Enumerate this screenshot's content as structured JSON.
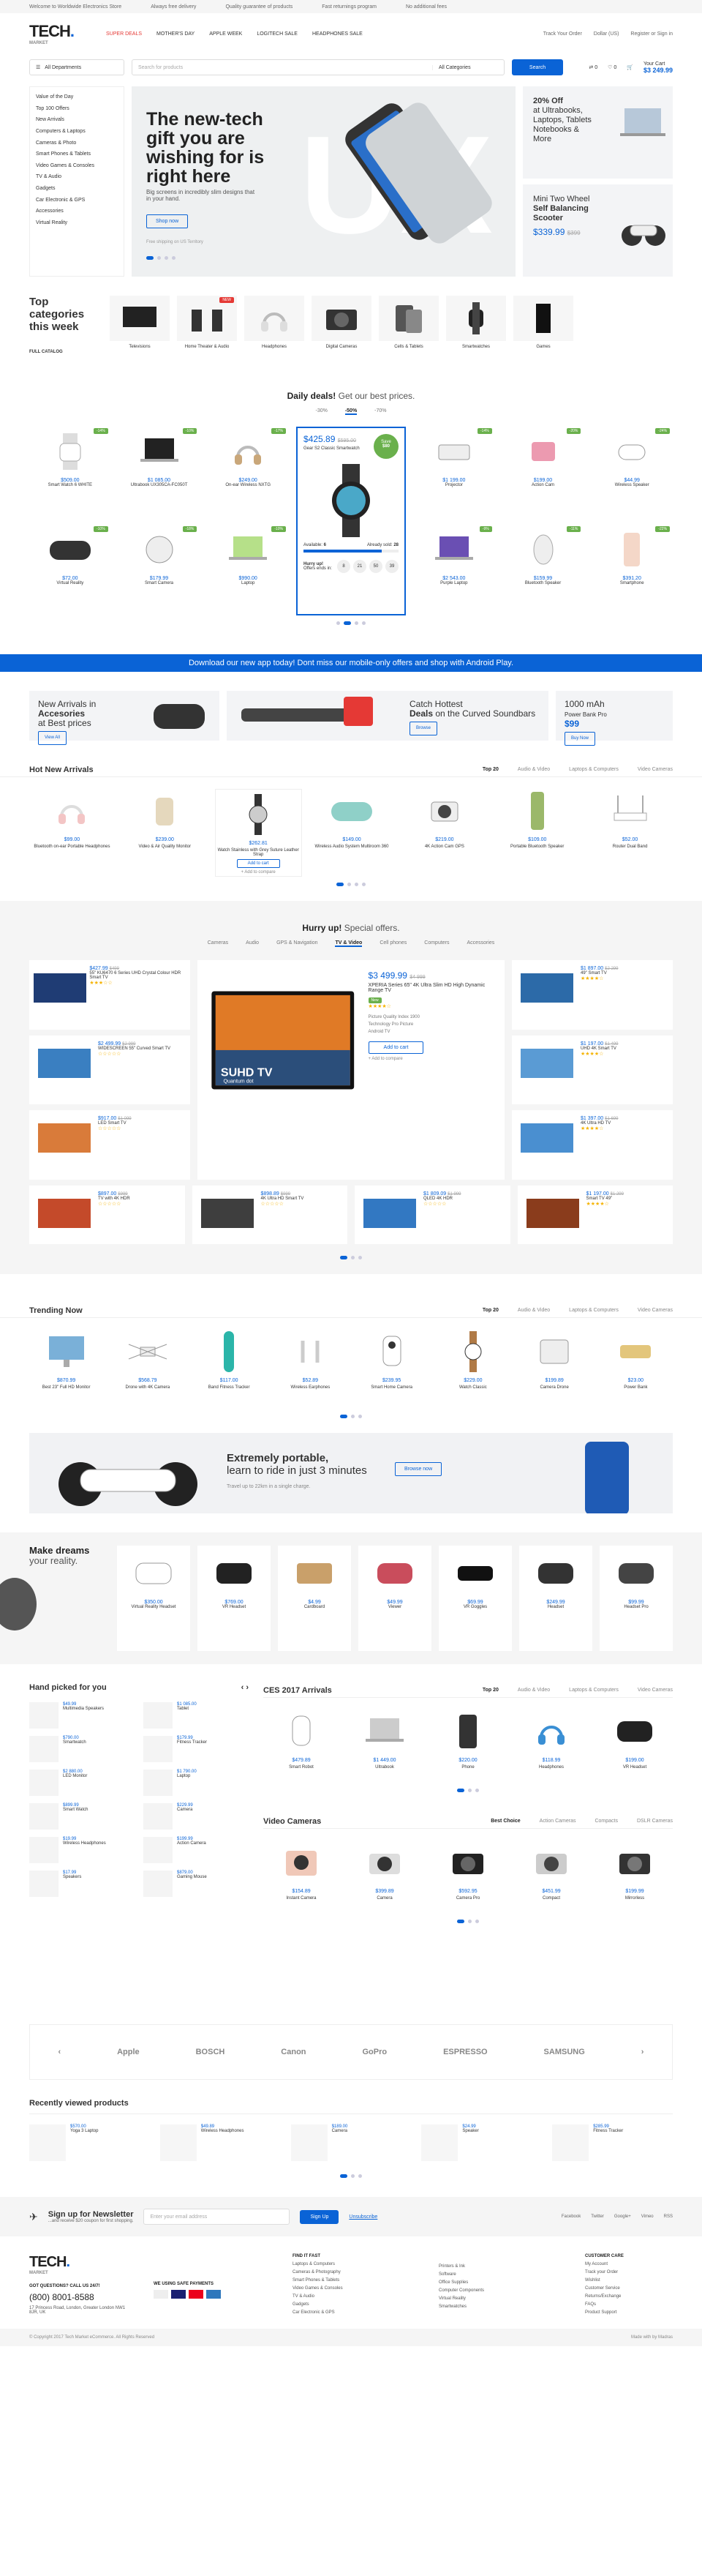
{
  "topbar": {
    "msg1": "Welcome to Worldwide Electronics Store",
    "msg2": "Always free delivery",
    "msg3": "Quality guarantee of products",
    "msg4": "Fast returnings program",
    "msg5": "No additional fees"
  },
  "logo": {
    "name": "TECH",
    "sub": "MARKET"
  },
  "nav": [
    "SUPER DEALS",
    "MOTHER'S DAY",
    "APPLE WEEK",
    "LOGITECH SALE",
    "HEADPHONES SALE"
  ],
  "header_right": {
    "track": "Track Your Order",
    "currency": "Dollar (US)",
    "account": "Register or Sign in"
  },
  "search": {
    "dept": "All Departments",
    "placeholder": "Search for products",
    "category": "All Categories",
    "button": "Search"
  },
  "cart": {
    "count1": "0",
    "count2": "0",
    "label": "Your Cart",
    "total": "$3 249.99"
  },
  "sidebar": [
    "Value of the Day",
    "Top 100 Offers",
    "New Arrivals",
    "Computers & Laptops",
    "Cameras & Photo",
    "Smart Phones & Tablets",
    "Video Games & Consoles",
    "TV & Audio",
    "Gadgets",
    "Car Electronic & GPS",
    "Accessories",
    "Virtual Reality"
  ],
  "hero": {
    "title": "The new-tech gift you are wishing for is right here",
    "desc": "Big screens in incredibly slim designs that in your hand.",
    "button": "Shop now",
    "ship": "Free shipping on US Territory"
  },
  "promo1": {
    "a": "20% Off",
    "b": "at Ultrabooks,",
    "c": "Laptops, Tablets",
    "d": "Notebooks &",
    "e": "More"
  },
  "promo2": {
    "a": "Mini Two Wheel",
    "b": "Self Balancing",
    "c": "Scooter",
    "price": "$339.99",
    "old": "$399"
  },
  "categories": {
    "title": "Top categories this week",
    "link": "FULL CATALOG",
    "items": [
      "Televisions",
      "Home Theater & Audio",
      "Headphones",
      "Digital Cameras",
      "Cells & Tablets",
      "Smartwatches",
      "Games"
    ],
    "badge": "NEW"
  },
  "deals": {
    "title": "Daily deals!",
    "sub": "Get our best prices.",
    "tabs": [
      "-30%",
      "-50%",
      "-70%"
    ]
  },
  "deal_items": [
    {
      "name": "Smart Watch 6 WHITE",
      "price": "$509.00",
      "old": "$599",
      "badge": "-14%"
    },
    {
      "name": "Ultrabook UX305CA-FC050T",
      "price": "$1 085.00",
      "old": "$1 215",
      "badge": "-10%"
    },
    {
      "name": "On-ear Wireless NXTG",
      "price": "$249.00",
      "old": "$299",
      "badge": "-17%"
    },
    {
      "name": "Ultra Wireless S50 Headphones",
      "price": "$150.00",
      "old": "$175",
      "badge": "-14%"
    },
    {
      "name": "Virtual Reality",
      "price": "$72.00",
      "old": "$80",
      "badge": "-10%"
    },
    {
      "name": "Smart Camera",
      "price": "$179.99",
      "old": "$220",
      "badge": "-18%"
    },
    {
      "name": "Tablet White 32GB",
      "price": "$110.00",
      "old": "$130",
      "badge": "-15%"
    },
    {
      "name": "Laptop",
      "price": "$990.00",
      "old": "$1 100",
      "badge": "-10%"
    },
    {
      "name": "Projector",
      "price": "$1 199.00",
      "old": "$1 399",
      "badge": "-14%"
    },
    {
      "name": "Action Cam",
      "price": "$199.00",
      "old": "$249",
      "badge": "-20%"
    },
    {
      "name": "Wireless Speaker",
      "price": "$44.99",
      "old": "$59",
      "badge": "-24%"
    },
    {
      "name": "Purple Laptop",
      "price": "$2 543.00",
      "old": "$2 799",
      "badge": "-9%"
    },
    {
      "name": "Bluetooth Speaker",
      "price": "$159.99",
      "old": "$179",
      "badge": "-11%"
    },
    {
      "name": "Smartphone",
      "price": "$391.20",
      "old": "$499",
      "badge": "-22%"
    }
  ],
  "featured": {
    "price": "$425.89",
    "old": "$595.00",
    "name": "Gear S2 Classic Smartwatch",
    "save": "Save",
    "saveamt": "$80",
    "available": "Available:",
    "availnum": "6",
    "sold": "Already sold:",
    "soldnum": "28",
    "hurry": "Hurry up!",
    "offer": "Offers ends in:",
    "d": "8",
    "h": "21",
    "m": "50",
    "s": "39"
  },
  "appbar": "Download our new app today! Dont miss our mobile-only offers and shop with Android Play.",
  "ads": {
    "a1": "New Arrivals in",
    "a2": "Accesories",
    "a3": "at Best prices",
    "view": "View All",
    "c1": "Catch Hottest",
    "c2": "Deals",
    "c3": "on the Curved Soundbars",
    "browse": "Browse",
    "m1": "1000 mAh",
    "m2": "Power Bank Pro",
    "mp": "$99",
    "buy": "Buy Now"
  },
  "newarrivals": {
    "title": "Hot New Arrivals",
    "tabs": [
      "Top 20",
      "Audio & Video",
      "Laptops & Computers",
      "Video Cameras"
    ],
    "cart": "Add to cart",
    "compare": "+ Add to compare",
    "items": [
      {
        "name": "Bluetooth on-ear Portable Headphones",
        "price": "$99.00"
      },
      {
        "name": "Video & Air Quality Monitor",
        "price": "$239.00"
      },
      {
        "name": "Watch Stainless with Grey Suture Leather Strap",
        "price": "$262.81"
      },
      {
        "name": "Wireless Audio System Multiroom 360",
        "price": "$149.00"
      },
      {
        "name": "4K Action Cam GPS",
        "price": "$219.00"
      },
      {
        "name": "Portable Bluetooth Speaker",
        "price": "$109.00"
      },
      {
        "name": "Router Dual Band",
        "price": "$52.00"
      }
    ]
  },
  "special": {
    "title": "Hurry up!",
    "sub": "Special offers.",
    "tabs": [
      "Cameras",
      "Audio",
      "GPS & Navigation",
      "TV & Video",
      "Cell phones",
      "Computers",
      "Accessories"
    ],
    "left": [
      {
        "price": "$427.99",
        "old": "$499",
        "name": "55\" KU6470 6 Series UHD Crystal Colour HDR Smart TV"
      },
      {
        "price": "$2 499.99",
        "old": "$2 999",
        "name": "WIDESCREEN 55\" Curved Smart TV"
      },
      {
        "price": "$917.00",
        "old": "$1 099",
        "name": "LED Smart TV"
      }
    ],
    "mid": {
      "price": "$3 499.99",
      "old": "$4 999",
      "name": "XPERIA Series 65\" 4K Ultra Slim HD High Dynamic Range TV",
      "badge": "New",
      "f1": "Picture Quality Index 1900",
      "f2": "Technology Pro Picture",
      "f3": "Android TV",
      "cart": "Add to cart",
      "compare": "+ Add to compare",
      "brand": "SUHD TV",
      "brand2": "Quantum dot"
    },
    "right": [
      {
        "price": "$1 897.00",
        "old": "$2 299",
        "name": "49\" Smart TV"
      },
      {
        "price": "$1 197.00",
        "old": "$1 499",
        "name": "UHD 4K Smart TV"
      },
      {
        "price": "$1 397.00",
        "old": "$1 699",
        "name": "4K Ultra HD TV"
      }
    ],
    "bottom": [
      {
        "price": "$897.00",
        "old": "$999",
        "name": "TV with 4K HDR"
      },
      {
        "price": "$898.89",
        "old": "$999",
        "name": "4K Ultra HD Smart TV"
      },
      {
        "price": "$1 809.09",
        "old": "$1 999",
        "name": "QLED 4K HDR"
      },
      {
        "price": "$1 197.00",
        "old": "$1 299",
        "name": "Smart TV 49\""
      }
    ]
  },
  "trending": {
    "title": "Trending Now",
    "tabs": [
      "Top 20",
      "Audio & Video",
      "Laptops & Computers",
      "Video Cameras"
    ],
    "items": [
      {
        "name": "Best 23\" Full HD Monitor",
        "price": "$870.99"
      },
      {
        "name": "Drone with 4K Camera",
        "price": "$568.79"
      },
      {
        "name": "Band Fitness Tracker",
        "price": "$117.00"
      },
      {
        "name": "Wireless Earphones",
        "price": "$52.89"
      },
      {
        "name": "Smart Home Camera",
        "price": "$239.95"
      },
      {
        "name": "Watch Classic",
        "price": "$229.00"
      },
      {
        "name": "Camera Drone",
        "price": "$199.89"
      },
      {
        "name": "Power Bank",
        "price": "$23.00"
      }
    ]
  },
  "scooter": {
    "t1": "Extremely portable,",
    "t2": "learn to ride in just 3 minutes",
    "sub": "Travel up to 22km in a single charge.",
    "button": "Browse now"
  },
  "vr": {
    "t1": "Make dreams",
    "t2": "your reality.",
    "items": [
      {
        "name": "Virtual Reality Headset",
        "price": "$350.00"
      },
      {
        "name": "VR Headset",
        "price": "$769.00"
      },
      {
        "name": "Cardboard",
        "price": "$4.99"
      },
      {
        "name": "Viewer",
        "price": "$49.99"
      },
      {
        "name": "VR Goggles",
        "price": "$69.99"
      },
      {
        "name": "Headset",
        "price": "$249.99"
      },
      {
        "name": "Headset Pro",
        "price": "$99.99"
      }
    ]
  },
  "handpicked": {
    "title": "Hand picked for you",
    "items": [
      {
        "name": "Multimedia Speakers",
        "price": "$49.99"
      },
      {
        "name": "Tablet",
        "price": "$1 085.00"
      },
      {
        "name": "Smartwatch",
        "price": "$790.00"
      },
      {
        "name": "Fitness Tracker",
        "price": "$179.99"
      },
      {
        "name": "LED Monitor",
        "price": "$2 880.00"
      },
      {
        "name": "Laptop",
        "price": "$1 790.00"
      },
      {
        "name": "Smart Watch",
        "price": "$899.99"
      },
      {
        "name": "Camera",
        "price": "$229.99"
      },
      {
        "name": "Wireless Headphones",
        "price": "$19.99"
      },
      {
        "name": "Action Camera",
        "price": "$199.99"
      },
      {
        "name": "Speakers",
        "price": "$17.99"
      },
      {
        "name": "Gaming Mouse",
        "price": "$879.00"
      }
    ]
  },
  "ces": {
    "title": "CES 2017 Arrivals",
    "tabs": [
      "Top 20",
      "Audio & Video",
      "Laptops & Computers",
      "Video Cameras"
    ],
    "items": [
      {
        "name": "Smart Robot",
        "price": "$479.89"
      },
      {
        "name": "Ultrabook",
        "price": "$1 449.00"
      },
      {
        "name": "Phone",
        "price": "$220.00"
      },
      {
        "name": "Headphones",
        "price": "$118.99"
      },
      {
        "name": "VR Headset",
        "price": "$199.00"
      }
    ]
  },
  "cams": {
    "title": "Video Cameras",
    "tabs": [
      "Best Choice",
      "Action Cameras",
      "Compacts",
      "DSLR Cameras"
    ],
    "items": [
      {
        "name": "Instant Camera",
        "price": "$154.89"
      },
      {
        "name": "Camera",
        "price": "$399.89"
      },
      {
        "name": "Camera Pro",
        "price": "$592.95"
      },
      {
        "name": "Compact",
        "price": "$451.99"
      },
      {
        "name": "Mirrorless",
        "price": "$199.99"
      }
    ]
  },
  "brands": [
    "Apple",
    "BOSCH",
    "Canon",
    "GoPro",
    "ESPRESSO",
    "SAMSUNG"
  ],
  "recent": {
    "title": "Recently viewed products",
    "items": [
      {
        "name": "Yoga 3 Laptop",
        "price": "$570.00"
      },
      {
        "name": "Wireless Headphones",
        "price": "$49.89"
      },
      {
        "name": "Camera",
        "price": "$189.00"
      },
      {
        "name": "Speaker",
        "price": "$24.99"
      },
      {
        "name": "Fitness Tracker",
        "price": "$285.99"
      }
    ]
  },
  "newsletter": {
    "title": "Sign up for Newsletter",
    "sub": "...and receive $20 coupon for first shopping.",
    "placeholder": "Enter your email address",
    "button": "Sign Up",
    "unsub": "Unsubscribe",
    "social": [
      "Facebook",
      "Twitter",
      "Google+",
      "Vimeo",
      "RSS"
    ]
  },
  "footer": {
    "q": "GOT QUESTIONS? CALL US 24/7!",
    "phone": "(800) 8001-8588",
    "addr": "17 Princess Road, London, Greater London NW1 8JR, UK",
    "pay": "WE USING SAFE PAYMENTS",
    "find": "FIND IT FAST",
    "c1": [
      "Laptops & Computers",
      "Cameras & Photography",
      "Smart Phones & Tablets",
      "Video Games & Consoles",
      "TV & Audio",
      "Gadgets",
      "Car Electronic & GPS"
    ],
    "c2": [
      "Printers & Ink",
      "Software",
      "Office Supplies",
      "Computer Components",
      "Virtual Reality",
      "Smartwatches"
    ],
    "care": "CUSTOMER CARE",
    "c3": [
      "My Account",
      "Track your Order",
      "Wishlist",
      "Customer Service",
      "Returns/Exchange",
      "FAQs",
      "Product Support"
    ]
  },
  "copyright": "© Copyright 2017 Tech Market eCommerce. All Rights Reserved",
  "madewith": "Made with by Madras"
}
